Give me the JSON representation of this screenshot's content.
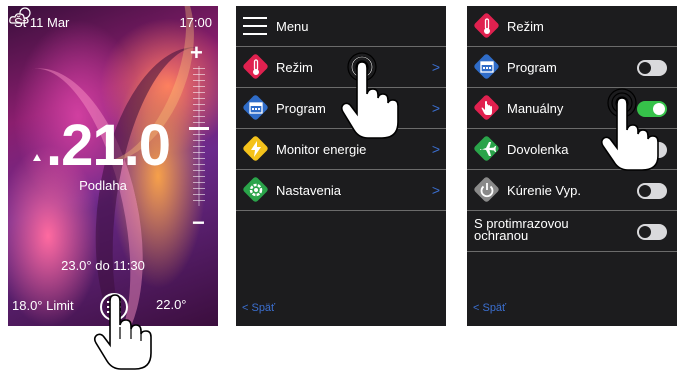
{
  "home": {
    "date": "Št 11 Mar",
    "time": "17:00",
    "temperature": ".21.0",
    "sensor": "Podlaha",
    "plus": "+",
    "minus": "−",
    "until": "23.0° do 11:30",
    "limit": "18.0° Limit",
    "setpoint": "22.0°"
  },
  "menu": {
    "title": "Menu",
    "items": [
      {
        "label": "Režim",
        "icon": "thermometer-icon",
        "color": "#e0214f"
      },
      {
        "label": "Program",
        "icon": "calendar-icon",
        "color": "#2f6cc8"
      },
      {
        "label": "Monitor energie",
        "icon": "lightning-icon",
        "color": "#f4c21b"
      },
      {
        "label": "Nastavenia",
        "icon": "gear-icon",
        "color": "#2aa44a"
      }
    ],
    "chevron": ">",
    "back": "< Späť"
  },
  "rezim": {
    "items": [
      {
        "label": "Režim",
        "icon": "thermometer-icon",
        "color": "#e0214f"
      },
      {
        "label": "Program",
        "icon": "calendar-icon",
        "color": "#2f6cc8",
        "toggle": "off"
      },
      {
        "label": "Manuálny",
        "icon": "hand-icon",
        "color": "#e0214f",
        "toggle": "on"
      },
      {
        "label": "Dovolenka",
        "icon": "airplane-icon",
        "color": "#2aa44a",
        "toggle": "off"
      },
      {
        "label": "Kúrenie Vyp.",
        "icon": "power-icon",
        "color": "#8a8a8a",
        "toggle": "off"
      },
      {
        "label": "S protimrazovou ochranou",
        "toggle": "off"
      }
    ],
    "back": "< Späť"
  }
}
